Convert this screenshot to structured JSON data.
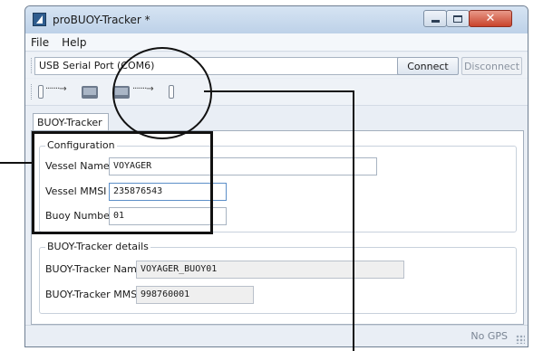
{
  "window": {
    "title": "proBUOY-Tracker *"
  },
  "menu": {
    "items": [
      {
        "label": "File"
      },
      {
        "label": "Help"
      }
    ]
  },
  "toolbar": {
    "port_value": "USB Serial Port (COM6)",
    "connect_label": "Connect",
    "disconnect_label": "Disconnect"
  },
  "tabs": [
    {
      "label": "BUOY-Tracker"
    }
  ],
  "configuration": {
    "title": "Configuration",
    "vessel_name_label": "Vessel Name",
    "vessel_name_value": "VOYAGER",
    "vessel_mmsi_label": "Vessel MMSI",
    "vessel_mmsi_value": "235876543",
    "buoy_number_label": "Buoy Number",
    "buoy_number_value": "01"
  },
  "details": {
    "title": "BUOY-Tracker details",
    "name_label": "BUOY-Tracker Name",
    "name_value": "VOYAGER_BUOY01",
    "mmsi_label": "BUOY-Tracker MMSI",
    "mmsi_value": "998760001"
  },
  "status": {
    "gps": "No GPS"
  }
}
